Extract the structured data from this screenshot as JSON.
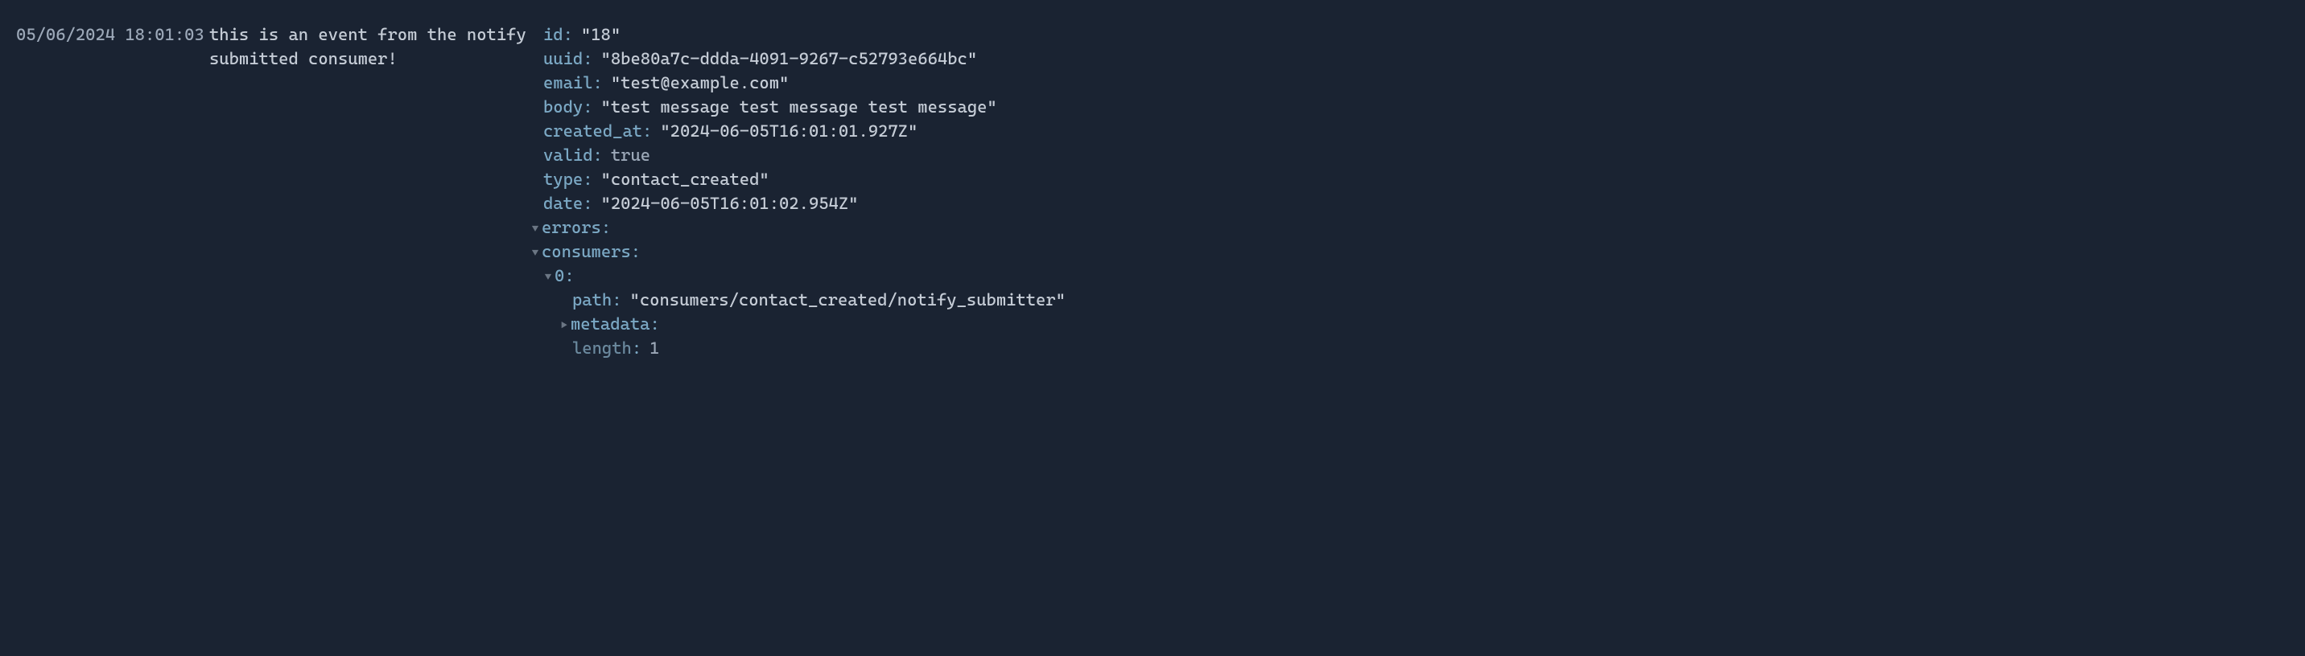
{
  "log": {
    "timestamp": "05/06/2024 18:01:03",
    "message": "this is an event from the notify submitted consumer!"
  },
  "event": {
    "fields": [
      {
        "key": "id",
        "value": "18",
        "type": "string"
      },
      {
        "key": "uuid",
        "value": "8be80a7c-ddda-4091-9267-c52793e664bc",
        "type": "string"
      },
      {
        "key": "email",
        "value": "test@example.com",
        "type": "string"
      },
      {
        "key": "body",
        "value": "test message test message test message",
        "type": "string"
      },
      {
        "key": "created_at",
        "value": "2024-06-05T16:01:01.927Z",
        "type": "string"
      },
      {
        "key": "valid",
        "value": "true",
        "type": "bool"
      },
      {
        "key": "type",
        "value": "contact_created",
        "type": "string"
      },
      {
        "key": "date",
        "value": "2024-06-05T16:01:02.954Z",
        "type": "string"
      }
    ],
    "errors_label": "errors",
    "consumers_label": "consumers",
    "consumer_index": "0",
    "consumer_path_key": "path",
    "consumer_path_value": "consumers/contact_created/notify_submitter",
    "metadata_label": "metadata",
    "length_label": "length",
    "length_value": "1"
  },
  "chart_data": {
    "type": "table",
    "title": "Event log entry",
    "rows": [
      {
        "key": "id",
        "value": "18"
      },
      {
        "key": "uuid",
        "value": "8be80a7c-ddda-4091-9267-c52793e664bc"
      },
      {
        "key": "email",
        "value": "test@example.com"
      },
      {
        "key": "body",
        "value": "test message test message test message"
      },
      {
        "key": "created_at",
        "value": "2024-06-05T16:01:01.927Z"
      },
      {
        "key": "valid",
        "value": true
      },
      {
        "key": "type",
        "value": "contact_created"
      },
      {
        "key": "date",
        "value": "2024-06-05T16:01:02.954Z"
      },
      {
        "key": "errors",
        "value": []
      },
      {
        "key": "consumers",
        "value": [
          {
            "path": "consumers/contact_created/notify_submitter",
            "metadata": {}
          }
        ]
      },
      {
        "key": "length",
        "value": 1
      }
    ]
  }
}
